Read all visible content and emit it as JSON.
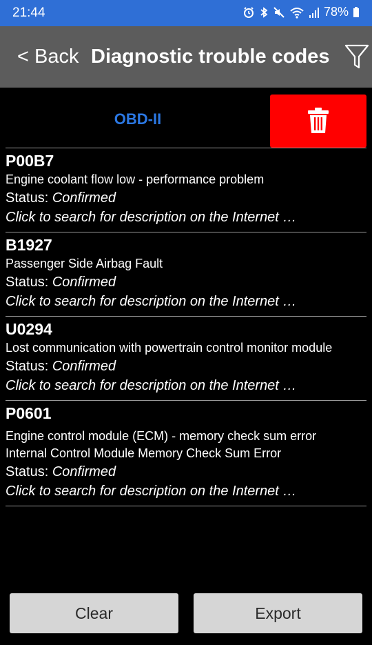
{
  "status_bar": {
    "time": "21:44",
    "battery": "78%",
    "icons": [
      "alarm-icon",
      "bluetooth-icon",
      "mute-icon",
      "wifi-icon",
      "signal-icon",
      "battery-icon"
    ]
  },
  "header": {
    "back_label": "< Back",
    "title": "Diagnostic trouble codes",
    "filter_icon": "filter-icon"
  },
  "protocol": {
    "label": "OBD-II",
    "delete_icon": "trash-icon"
  },
  "dtcs": [
    {
      "code": "P00B7",
      "descriptions": [
        "Engine coolant flow low - performance problem"
      ],
      "status_label": "Status:",
      "status_value": "Confirmed",
      "search_hint": "Click to search for description on the Internet …"
    },
    {
      "code": "B1927",
      "descriptions": [
        "Passenger Side Airbag Fault"
      ],
      "status_label": "Status:",
      "status_value": "Confirmed",
      "search_hint": "Click to search for description on the Internet …"
    },
    {
      "code": "U0294",
      "descriptions": [
        "Lost communication with powertrain control monitor module"
      ],
      "status_label": "Status:",
      "status_value": "Confirmed",
      "search_hint": "Click to search for description on the Internet …"
    },
    {
      "code": "P0601",
      "descriptions": [
        "Engine control module (ECM) - memory check sum error",
        "Internal Control Module Memory Check Sum Error"
      ],
      "status_label": "Status:",
      "status_value": "Confirmed",
      "search_hint": "Click to search for description on the Internet …"
    }
  ],
  "buttons": {
    "clear": "Clear",
    "export": "Export"
  },
  "colors": {
    "status_bar": "#2f6fd6",
    "header": "#5c5c5c",
    "protocol_text": "#2b78e4",
    "delete_button": "#ff0000",
    "bottom_buttons": "#d6d6d6"
  }
}
